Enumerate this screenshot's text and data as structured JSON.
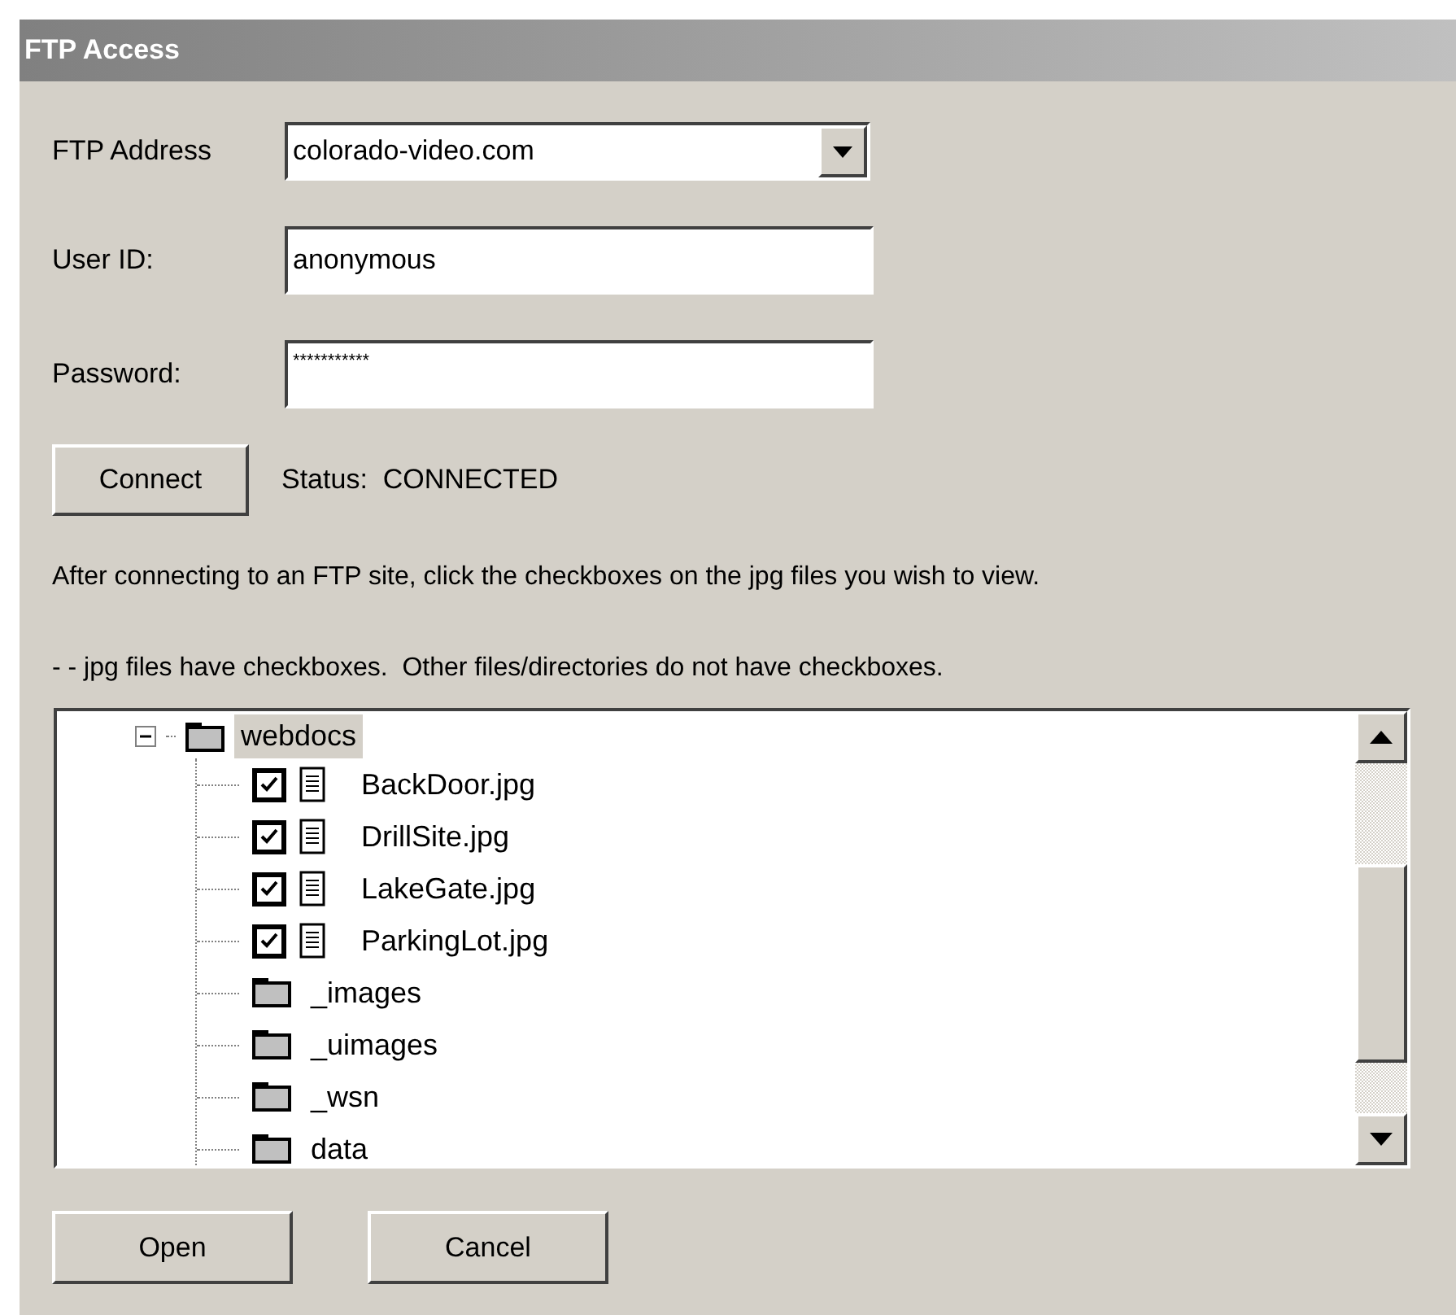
{
  "window": {
    "title": "FTP Access"
  },
  "fields": [
    {
      "kind": "combo",
      "label": "FTP Address",
      "value": "colorado-video.com"
    },
    {
      "kind": "text",
      "label": "User ID:",
      "value": "anonymous"
    },
    {
      "kind": "text",
      "label": "Password:",
      "value": "***********"
    }
  ],
  "connect_button": "Connect",
  "status": "Status:  CONNECTED",
  "instructions": [
    "After connecting to an FTP site, click the checkboxes on the jpg files you wish to view.",
    "- - jpg files have checkboxes.  Other files/directories do not have checkboxes."
  ],
  "tree": {
    "label": "webdocs",
    "kind": "folder",
    "expanded": true,
    "selected": true,
    "children": [
      {
        "kind": "file",
        "label": "BackDoor.jpg",
        "checked": true,
        "selected": false
      },
      {
        "kind": "file",
        "label": "DrillSite.jpg",
        "checked": true,
        "selected": false
      },
      {
        "kind": "file",
        "label": "LakeGate.jpg",
        "checked": true,
        "selected": false
      },
      {
        "kind": "file",
        "label": "ParkingLot.jpg",
        "checked": true,
        "selected": false
      },
      {
        "kind": "folder",
        "label": "_images",
        "selected": false
      },
      {
        "kind": "folder",
        "label": "_uimages",
        "selected": false
      },
      {
        "kind": "folder",
        "label": "_wsn",
        "selected": false
      },
      {
        "kind": "folder",
        "label": "data",
        "selected": false
      }
    ]
  },
  "buttons": [
    "Open",
    "Cancel"
  ]
}
